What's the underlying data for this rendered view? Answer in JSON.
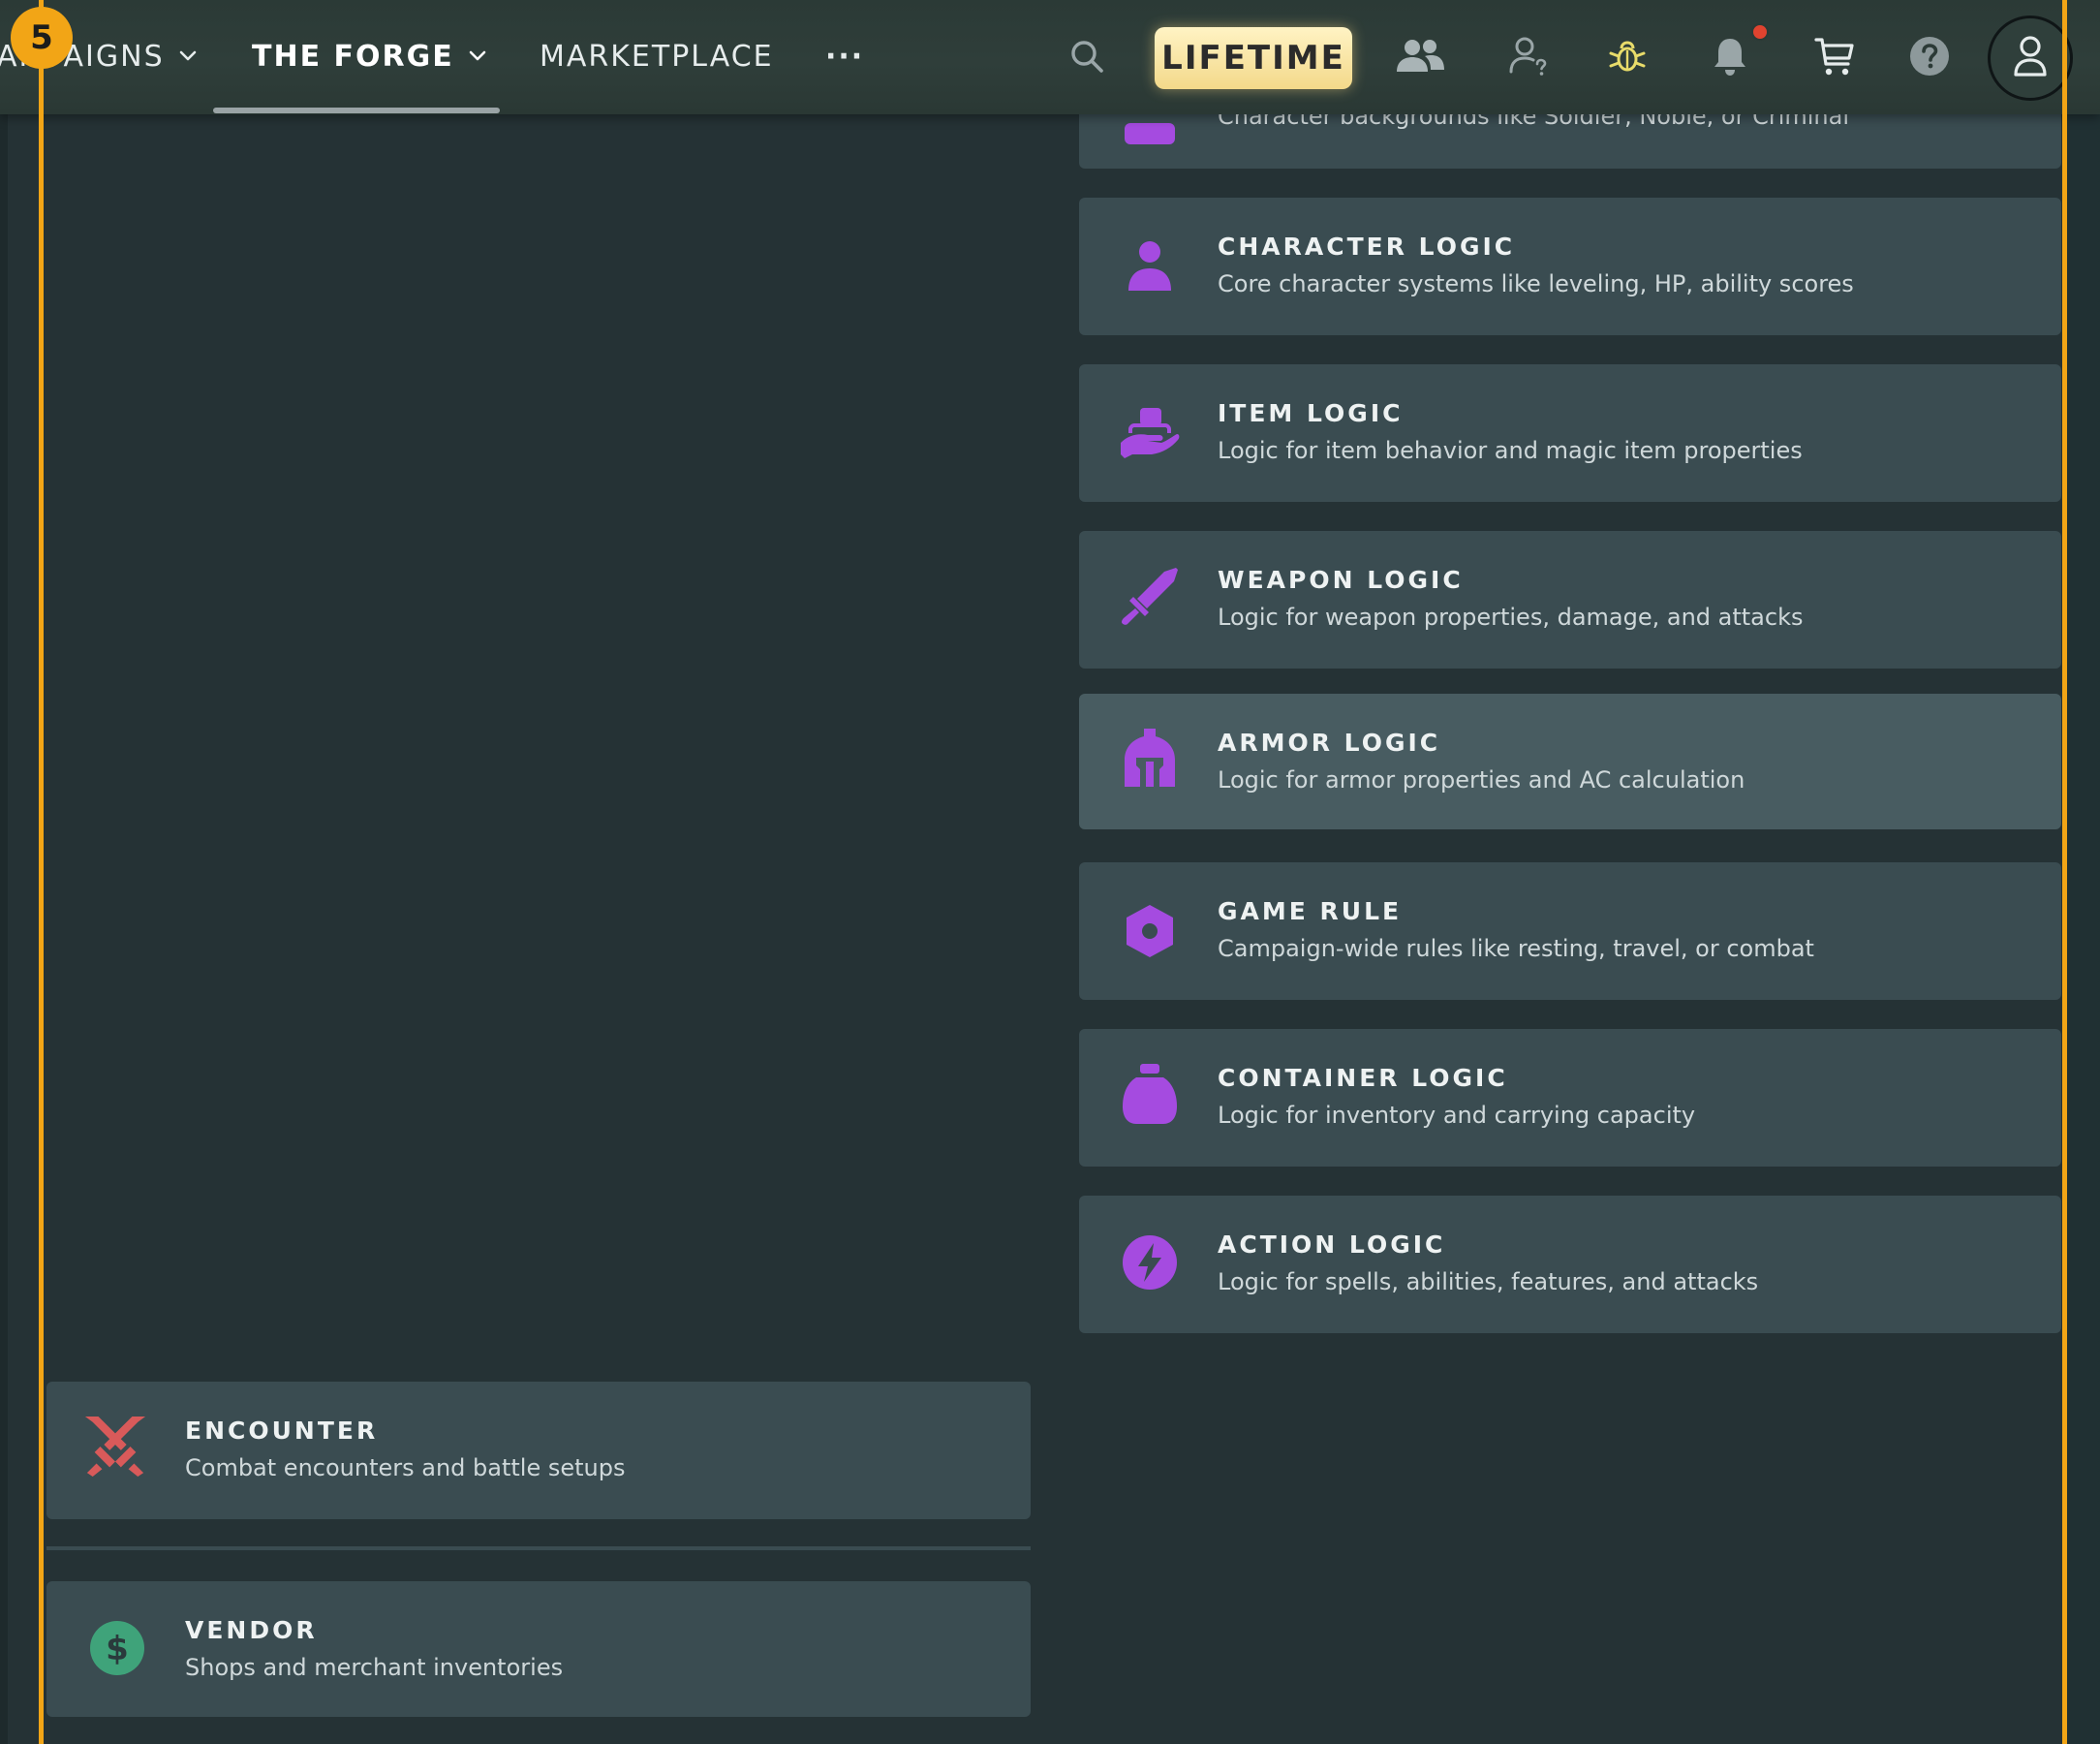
{
  "step_badge": "5",
  "nav": {
    "campaigns_label": "CAMPAIGNS",
    "forge_label": "THE FORGE",
    "marketplace_label": "MARKETPLACE",
    "more_label": "···",
    "lifetime_label": "LIFETIME"
  },
  "icons": {
    "search": "search-icon",
    "friends": "people-icon",
    "support": "user-question-icon",
    "bug": "bug-icon",
    "notifications": "bell-icon",
    "cart": "cart-icon",
    "help": "help-icon",
    "account": "user-icon"
  },
  "colors": {
    "accent_frame": "#f2a516",
    "logic_icon": "#a54be0",
    "encounter_icon": "#d85a5a",
    "vendor_icon": "#3fa37a",
    "card_bg": "#3a4c51",
    "page_bg": "#253235"
  },
  "left_cards": [
    {
      "title": "ENCOUNTER",
      "desc": "Combat encounters and battle setups",
      "icon": "crossed-swords-icon"
    },
    {
      "title": "VENDOR",
      "desc": "Shops and merchant inventories",
      "icon": "dollar-coin-icon"
    }
  ],
  "right_cards": [
    {
      "title": "",
      "desc": "Character backgrounds like Soldier, Noble, or Criminal",
      "icon": "background-icon"
    },
    {
      "title": "CHARACTER LOGIC",
      "desc": "Core character systems like leveling, HP, ability scores",
      "icon": "person-icon"
    },
    {
      "title": "ITEM LOGIC",
      "desc": "Logic for item behavior and magic item properties",
      "icon": "hand-holding-item-icon"
    },
    {
      "title": "WEAPON LOGIC",
      "desc": "Logic for weapon properties, damage, and attacks",
      "icon": "sword-icon"
    },
    {
      "title": "ARMOR LOGIC",
      "desc": "Logic for armor properties and AC calculation",
      "icon": "helmet-icon"
    },
    {
      "title": "GAME RULE",
      "desc": "Campaign-wide rules like resting, travel, or combat",
      "icon": "hexagon-nut-icon"
    },
    {
      "title": "CONTAINER LOGIC",
      "desc": "Logic for inventory and carrying capacity",
      "icon": "sack-icon"
    },
    {
      "title": "ACTION LOGIC",
      "desc": "Logic for spells, abilities, features, and attacks",
      "icon": "lightning-bolt-icon"
    }
  ]
}
